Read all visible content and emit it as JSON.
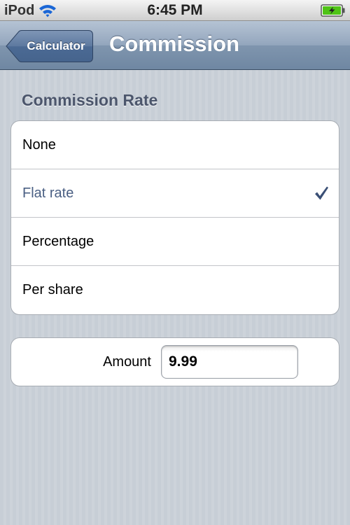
{
  "status_bar": {
    "carrier": "iPod",
    "time": "6:45 PM",
    "wifi_icon": "wifi-icon",
    "battery_icon": "battery-charging-icon",
    "battery_level": 1.0,
    "battery_color": "#4fc316"
  },
  "nav": {
    "back_label": "Calculator",
    "title": "Commission"
  },
  "section": {
    "header": "Commission Rate"
  },
  "commission_options": [
    {
      "label": "None",
      "selected": false
    },
    {
      "label": "Flat rate",
      "selected": true
    },
    {
      "label": "Percentage",
      "selected": false
    },
    {
      "label": "Per share",
      "selected": false
    }
  ],
  "checkmark_icon": "checkmark-icon",
  "amount": {
    "label": "Amount",
    "value": "9.99"
  },
  "colors": {
    "nav_bar": "#7f95ae",
    "selected_text": "#4a5f83",
    "section_header": "#4c566c",
    "background": "#c5ccd4"
  }
}
